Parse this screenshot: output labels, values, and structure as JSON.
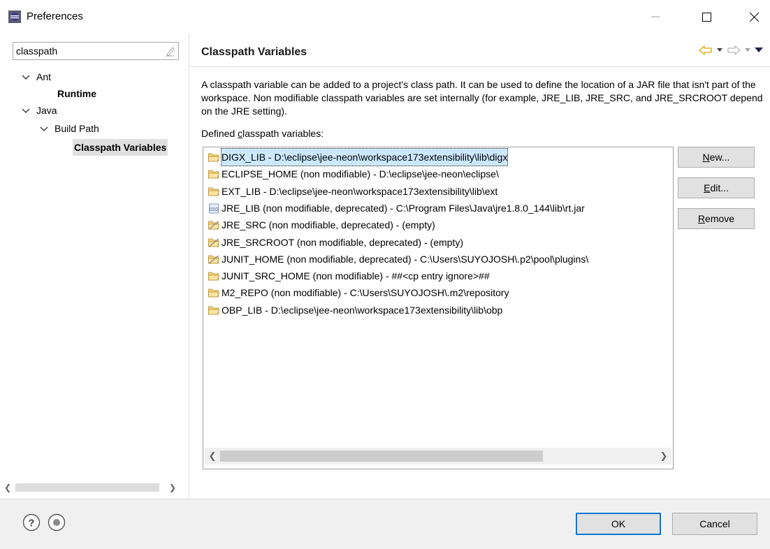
{
  "window": {
    "title": "Preferences"
  },
  "filter": {
    "value": "classpath"
  },
  "tree": {
    "items": [
      {
        "label": "Ant"
      },
      {
        "label": "Runtime"
      },
      {
        "label": "Java"
      },
      {
        "label": "Build Path"
      },
      {
        "label": "Classpath Variables"
      }
    ]
  },
  "page": {
    "title": "Classpath Variables",
    "description": "A classpath variable can be added to a project's class path. It can be used to define the location of a JAR file that isn't part of the workspace. Non modifiable classpath variables are set internally (for example, JRE_LIB, JRE_SRC, and JRE_SRCROOT depend on the JRE setting).",
    "defined_label_prefix": "Defined ",
    "defined_label_mnemonic": "c",
    "defined_label_suffix": "lasspath variables:"
  },
  "variables": [
    {
      "label": "DIGX_LIB - D:\\eclipse\\jee-neon\\workspace173extensibility\\lib\\digx",
      "icon": "folder-icon",
      "selected": true
    },
    {
      "label": "ECLIPSE_HOME (non modifiable) - D:\\eclipse\\jee-neon\\eclipse\\",
      "icon": "folder-icon"
    },
    {
      "label": "EXT_LIB - D:\\eclipse\\jee-neon\\workspace173extensibility\\lib\\ext",
      "icon": "folder-icon"
    },
    {
      "label": "JRE_LIB (non modifiable, deprecated) - C:\\Program Files\\Java\\jre1.8.0_144\\lib\\rt.jar",
      "icon": "jar-icon"
    },
    {
      "label": "JRE_SRC (non modifiable, deprecated) - (empty)",
      "icon": "deprecated-folder-icon"
    },
    {
      "label": "JRE_SRCROOT (non modifiable, deprecated) - (empty)",
      "icon": "deprecated-folder-icon"
    },
    {
      "label": "JUNIT_HOME (non modifiable, deprecated) - C:\\Users\\SUYOJOSH\\.p2\\pool\\plugins\\",
      "icon": "deprecated-folder-icon"
    },
    {
      "label": "JUNIT_SRC_HOME (non modifiable) - ##<cp entry ignore>##",
      "icon": "folder-icon"
    },
    {
      "label": "M2_REPO (non modifiable) - C:\\Users\\SUYOJOSH\\.m2\\repository",
      "icon": "folder-icon"
    },
    {
      "label": "OBP_LIB - D:\\eclipse\\jee-neon\\workspace173extensibility\\lib\\obp",
      "icon": "folder-icon"
    }
  ],
  "side_buttons": {
    "new": {
      "mnemonic": "N",
      "rest": "ew..."
    },
    "edit": {
      "mnemonic": "E",
      "rest": "dit..."
    },
    "remove": {
      "mnemonic": "R",
      "rest": "emove"
    }
  },
  "dialog_buttons": {
    "ok": "OK",
    "cancel": "Cancel"
  },
  "colors": {
    "selection": "#cce8ff",
    "button_bg": "#e1e1e1",
    "default_button_border": "#0078d7",
    "bottom_bar": "#f0f0f0"
  }
}
